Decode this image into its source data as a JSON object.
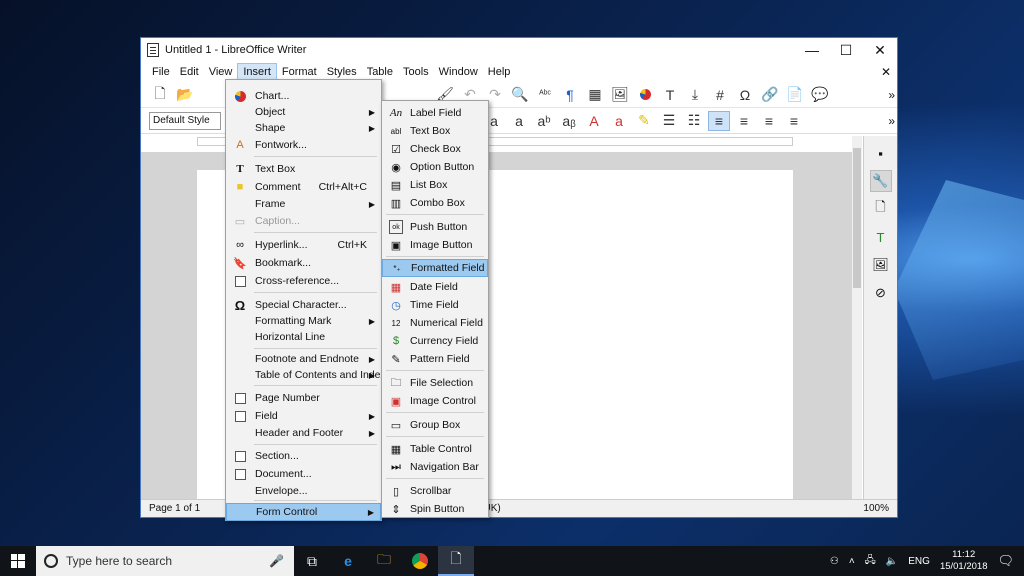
{
  "window": {
    "title": "Untitled 1 - LibreOffice Writer",
    "min": "—",
    "max": "☐",
    "close": "✕"
  },
  "menubar": [
    "File",
    "Edit",
    "View",
    "Insert",
    "Format",
    "Styles",
    "Table",
    "Tools",
    "Window",
    "Help"
  ],
  "toolbar": {
    "paragraph_style": "Default Style"
  },
  "status": {
    "page": "Page 1 of 1",
    "language": "(UK)",
    "zoom": "100%"
  },
  "insert_menu": {
    "items": [
      {
        "label": "Chart...",
        "icon": "chart-icon"
      },
      {
        "label": "Object",
        "submenu": true
      },
      {
        "label": "Shape",
        "submenu": true
      },
      {
        "label": "Fontwork...",
        "icon": "fontwork-icon"
      },
      {
        "label": "Text Box",
        "icon": "text-box-icon"
      },
      {
        "label": "Comment",
        "shortcut": "Ctrl+Alt+C",
        "icon": "comment-icon"
      },
      {
        "label": "Frame",
        "submenu": true
      },
      {
        "label": "Caption...",
        "disabled": true,
        "icon": "caption-icon"
      },
      {
        "label": "Hyperlink...",
        "shortcut": "Ctrl+K",
        "icon": "hyperlink-icon"
      },
      {
        "label": "Bookmark...",
        "icon": "bookmark-icon"
      },
      {
        "label": "Cross-reference...",
        "icon": "cross-reference-icon"
      },
      {
        "label": "Special Character...",
        "icon": "omega-icon"
      },
      {
        "label": "Formatting Mark",
        "submenu": true
      },
      {
        "label": "Horizontal Line"
      },
      {
        "label": "Footnote and Endnote",
        "submenu": true
      },
      {
        "label": "Table of Contents and Index",
        "submenu": true
      },
      {
        "label": "Page Number",
        "icon": "page-number-icon"
      },
      {
        "label": "Field",
        "submenu": true,
        "icon": "field-icon"
      },
      {
        "label": "Header and Footer",
        "submenu": true
      },
      {
        "label": "Section...",
        "icon": "section-icon"
      },
      {
        "label": "Document...",
        "icon": "document-icon"
      },
      {
        "label": "Envelope..."
      },
      {
        "label": "Form Control",
        "submenu": true,
        "highlighted": true
      }
    ]
  },
  "form_control_menu": {
    "items": [
      {
        "label": "Label Field",
        "icon": "label-field-icon"
      },
      {
        "label": "Text Box",
        "icon": "text-box-icon"
      },
      {
        "label": "Check Box",
        "icon": "check-box-icon"
      },
      {
        "label": "Option Button",
        "icon": "option-button-icon"
      },
      {
        "label": "List Box",
        "icon": "list-box-icon"
      },
      {
        "label": "Combo Box",
        "icon": "combo-box-icon"
      },
      {
        "label": "Push Button",
        "icon": "push-button-icon"
      },
      {
        "label": "Image Button",
        "icon": "image-button-icon"
      },
      {
        "label": "Formatted Field",
        "icon": "formatted-field-icon",
        "highlighted": true
      },
      {
        "label": "Date Field",
        "icon": "date-field-icon"
      },
      {
        "label": "Time Field",
        "icon": "time-field-icon"
      },
      {
        "label": "Numerical Field",
        "icon": "numerical-field-icon"
      },
      {
        "label": "Currency Field",
        "icon": "currency-field-icon"
      },
      {
        "label": "Pattern Field",
        "icon": "pattern-field-icon"
      },
      {
        "label": "File Selection",
        "icon": "file-selection-icon"
      },
      {
        "label": "Image Control",
        "icon": "image-control-icon"
      },
      {
        "label": "Group Box",
        "icon": "group-box-icon"
      },
      {
        "label": "Table Control",
        "icon": "table-control-icon"
      },
      {
        "label": "Navigation Bar",
        "icon": "navigation-bar-icon"
      },
      {
        "label": "Scrollbar",
        "icon": "scrollbar-icon"
      },
      {
        "label": "Spin Button",
        "icon": "spin-button-icon"
      }
    ]
  },
  "taskbar": {
    "search_placeholder": "Type here to search",
    "language": "ENG",
    "time": "11:12",
    "date": "15/01/2018"
  }
}
